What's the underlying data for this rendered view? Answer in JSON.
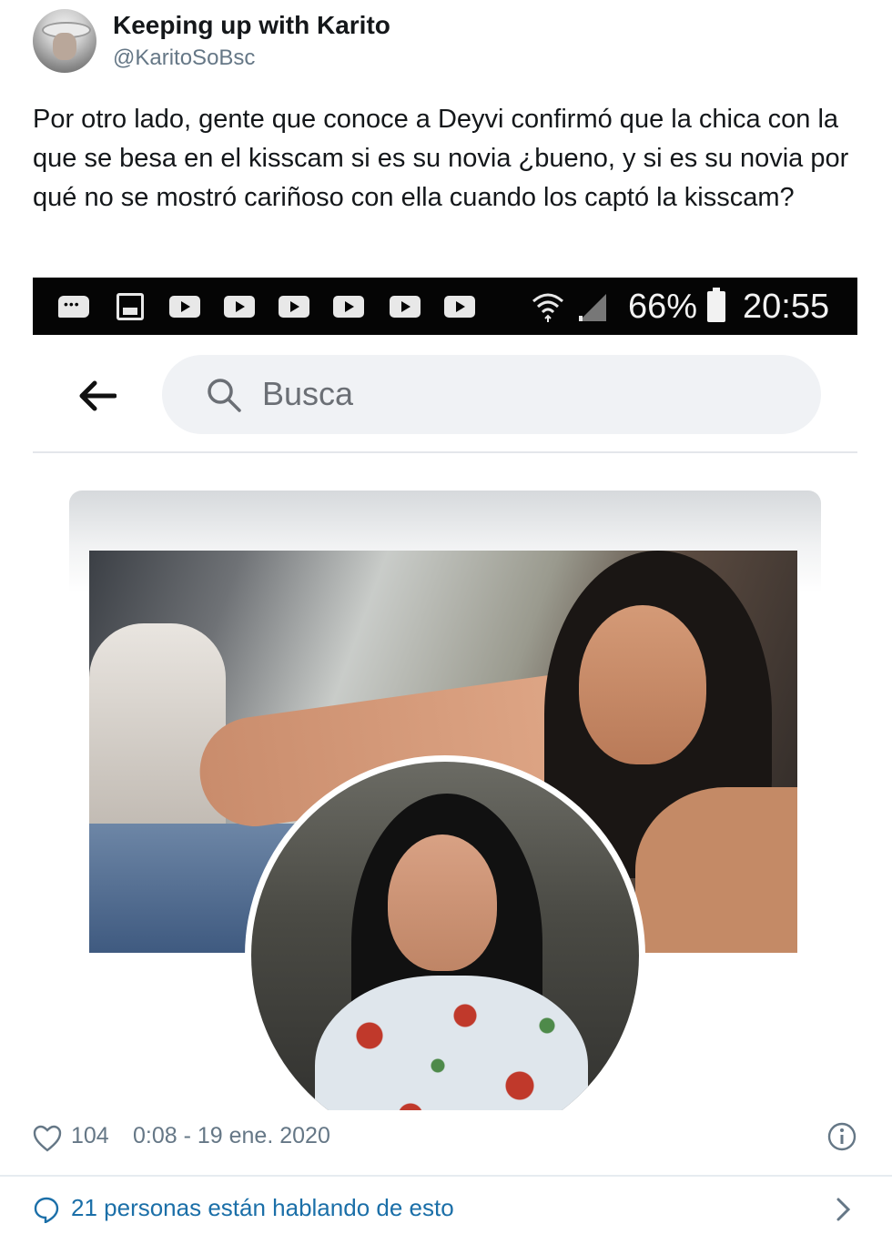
{
  "tweet": {
    "display_name": "Keeping up with Karito",
    "handle": "@KaritoSoBsc",
    "text": "Por otro lado, gente que conoce a Deyvi confirmó que la chica con la que se besa en el kisscam si es su novia ¿bueno, y si es su novia por qué no se mostró cariñoso con ella cuando los captó la kisscam?",
    "likes": "104",
    "timestamp": "0:08 - 19 ene. 2020",
    "conversation_link": "21 personas están hablando de esto"
  },
  "embedded_screenshot": {
    "status_bar": {
      "battery_percent": "66%",
      "time": "20:55",
      "notification_icons": [
        "message-icon",
        "image-icon",
        "youtube-icon",
        "youtube-icon",
        "youtube-icon",
        "youtube-icon",
        "youtube-icon",
        "youtube-icon"
      ]
    },
    "search": {
      "placeholder": "Busca"
    }
  },
  "colors": {
    "text_primary": "#14171a",
    "text_secondary": "#657786",
    "link": "#1b6fa8",
    "status_bar_bg": "#050505",
    "search_bg": "#f0f2f5"
  }
}
